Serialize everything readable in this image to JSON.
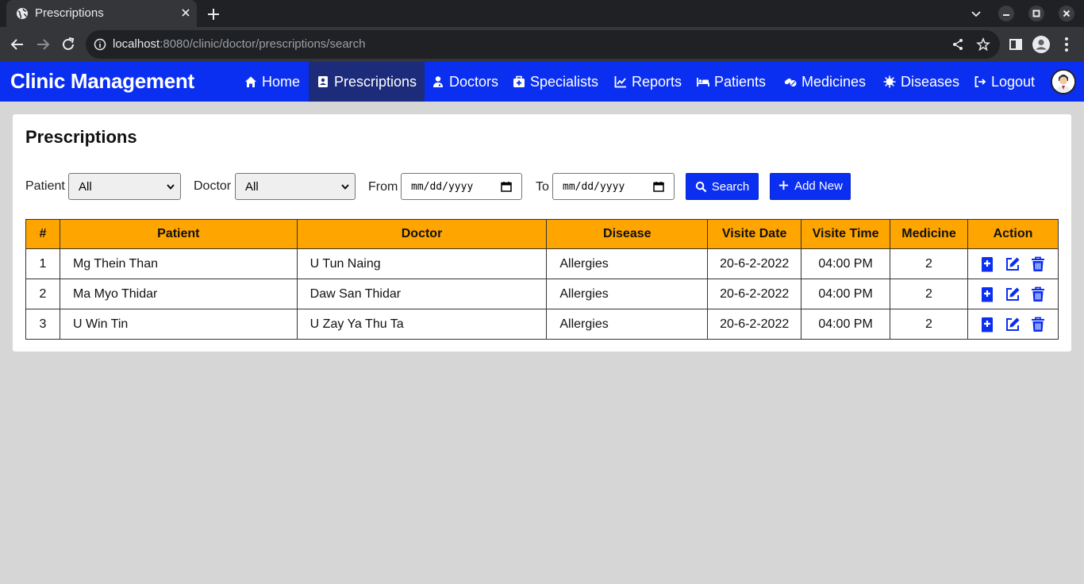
{
  "browser": {
    "tab_title": "Prescriptions",
    "url_host": "localhost",
    "url_path": ":8080/clinic/doctor/prescriptions/search"
  },
  "app": {
    "brand": "Clinic Management",
    "nav": [
      {
        "label": "Home",
        "icon": "home-icon"
      },
      {
        "label": "Prescriptions",
        "icon": "prescription-icon",
        "active": true
      },
      {
        "label": "Doctors",
        "icon": "doctor-icon"
      },
      {
        "label": "Specialists",
        "icon": "medkit-icon"
      },
      {
        "label": "Reports",
        "icon": "chart-line-icon"
      },
      {
        "label": "Patients",
        "icon": "bed-icon"
      },
      {
        "label": "Medicines",
        "icon": "pills-icon"
      },
      {
        "label": "Diseases",
        "icon": "virus-icon"
      },
      {
        "label": "Logout",
        "icon": "logout-icon"
      }
    ]
  },
  "page": {
    "title": "Prescriptions",
    "filters": {
      "patient_label": "Patient",
      "patient_value": "All",
      "doctor_label": "Doctor",
      "doctor_value": "All",
      "from_label": "From",
      "from_value": "mm/dd/yyyy",
      "to_label": "To",
      "to_value": "mm/dd/yyyy",
      "search_label": "Search",
      "add_label": "Add New"
    },
    "table": {
      "headers": [
        "#",
        "Patient",
        "Doctor",
        "Disease",
        "Visite Date",
        "Visite Time",
        "Medicine",
        "Action"
      ],
      "rows": [
        [
          "1",
          "Mg Thein Than",
          "U Tun Naing",
          "Allergies",
          "20-6-2-2022",
          "04:00 PM",
          "2"
        ],
        [
          "2",
          "Ma Myo Thidar",
          "Daw San Thidar",
          "Allergies",
          "20-6-2-2022",
          "04:00 PM",
          "2"
        ],
        [
          "3",
          "U Win Tin",
          "U Zay Ya Thu Ta",
          "Allergies",
          "20-6-2-2022",
          "04:00 PM",
          "2"
        ]
      ]
    },
    "colors": {
      "nav": "#0b2ff0",
      "nav_active": "#1c2b7a",
      "table_header": "#ffa500",
      "action_icon": "#0b2ff0"
    }
  }
}
